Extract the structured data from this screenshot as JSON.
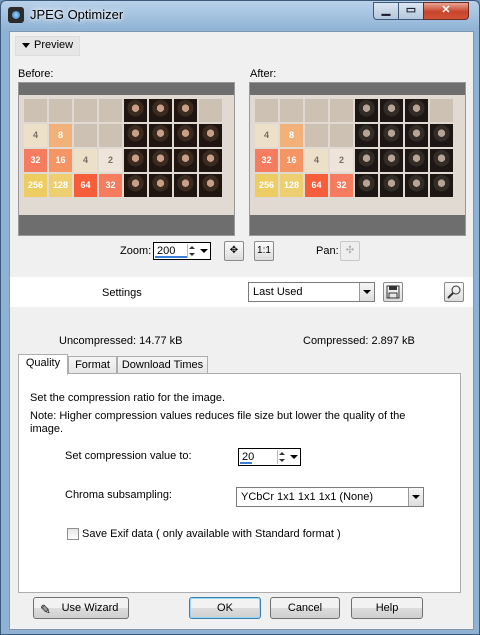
{
  "window": {
    "title": "JPEG Optimizer",
    "icon": "app-icon",
    "buttons": {
      "minimize": "▁",
      "maximize": "▭",
      "close": "✕"
    }
  },
  "preview": {
    "toggle_label": "Preview",
    "before_label": "Before:",
    "after_label": "After:",
    "tiles": [
      "",
      "",
      "",
      "",
      "face",
      "face",
      "face",
      "",
      "4",
      "8",
      "",
      "",
      "face",
      "face",
      "face",
      "face",
      "32",
      "16",
      "4",
      "2",
      "face",
      "face",
      "face",
      "face",
      "256",
      "128",
      "64",
      "32",
      "face",
      "face",
      "face",
      "face"
    ]
  },
  "zoom": {
    "label": "Zoom:",
    "value": "200"
  },
  "pan": {
    "label": "Pan:"
  },
  "settings": {
    "label": "Settings",
    "preset": "Last Used"
  },
  "sizes": {
    "uncompressed": "Uncompressed:  14.77 kB",
    "compressed": "Compressed: 2.897 kB"
  },
  "tabs": [
    "Quality",
    "Format",
    "Download Times"
  ],
  "quality": {
    "intro": "Set the compression ratio for the image.",
    "note_line1": "Note:  Higher compression values reduces file size but lower the quality of the",
    "note_line2": "image.",
    "compression_label": "Set compression value to:",
    "compression_value": "20",
    "chroma_label": "Chroma subsampling:",
    "chroma_value": "YCbCr  1x1  1x1  1x1  (None)",
    "exif_label": "Save Exif data ( only available with Standard format )",
    "exif_checked": false
  },
  "footer": {
    "wizard": "Use Wizard",
    "ok": "OK",
    "cancel": "Cancel",
    "help": "Help"
  },
  "colors": {
    "tile_2": "#eee4da",
    "tile_4": "#ede0c8",
    "tile_8": "#f2b179",
    "tile_16": "#f59563",
    "tile_32": "#f67c5f",
    "tile_64": "#f65e3b",
    "tile_128": "#edcf72",
    "tile_256": "#edcc61",
    "tile_empty": "#cdc1b4",
    "accent": "#3a7fd5"
  }
}
